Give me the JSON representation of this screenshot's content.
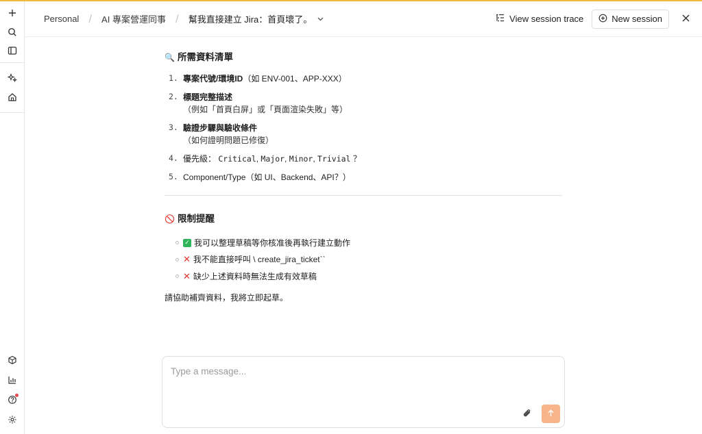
{
  "colors": {
    "accent": "#f2b73f",
    "send_button": "#f7b489"
  },
  "breadcrumb": {
    "items": [
      "Personal",
      "AI 專案營運同事",
      "幫我直接建立 Jira：首頁壞了。"
    ]
  },
  "header": {
    "view_trace_label": "View session trace",
    "new_session_label": "New session"
  },
  "sidebar": {
    "top_icons": [
      "plus-icon",
      "search-icon",
      "panel-icon",
      "sparkle-icon",
      "home-icon"
    ],
    "bottom_icons": [
      "box-icon",
      "chart-icon",
      "help-icon",
      "settings-icon"
    ]
  },
  "message": {
    "required_title": "所需資料清單",
    "required_icon": "🔍",
    "items": [
      {
        "num": "1.",
        "bold": "專案代號/環境ID",
        "rest": "（如 ENV-001、APP-XXX）",
        "sub": ""
      },
      {
        "num": "2.",
        "bold": "標題完整描述",
        "rest": "",
        "sub": "（例如「首頁白屏」或「頁面渲染失敗」等）"
      },
      {
        "num": "3.",
        "bold": "驗證步驟與驗收條件",
        "rest": "",
        "sub": "（如何證明問題已修復）"
      },
      {
        "num": "4.",
        "prefix": "優先級：",
        "codes": [
          "Critical",
          "Major",
          "Minor",
          "Trivial"
        ],
        "suffix": "？"
      },
      {
        "num": "5.",
        "plain": "Component/Type（如 UI、Backend、API？）"
      }
    ],
    "limits_title": "限制提醒",
    "limits_icon": "🚫",
    "limits": [
      {
        "mark": "check",
        "text": "我可以整理草稿等你核准後再執行建立動作"
      },
      {
        "mark": "cross",
        "text": "我不能直接呼叫 \\ create_jira_ticket``"
      },
      {
        "mark": "cross",
        "text": "缺少上述資料時無法生成有效草稿"
      }
    ],
    "closing": "請協助補齊資料，我將立即起草。"
  },
  "composer": {
    "placeholder": "Type a message...",
    "value": ""
  }
}
